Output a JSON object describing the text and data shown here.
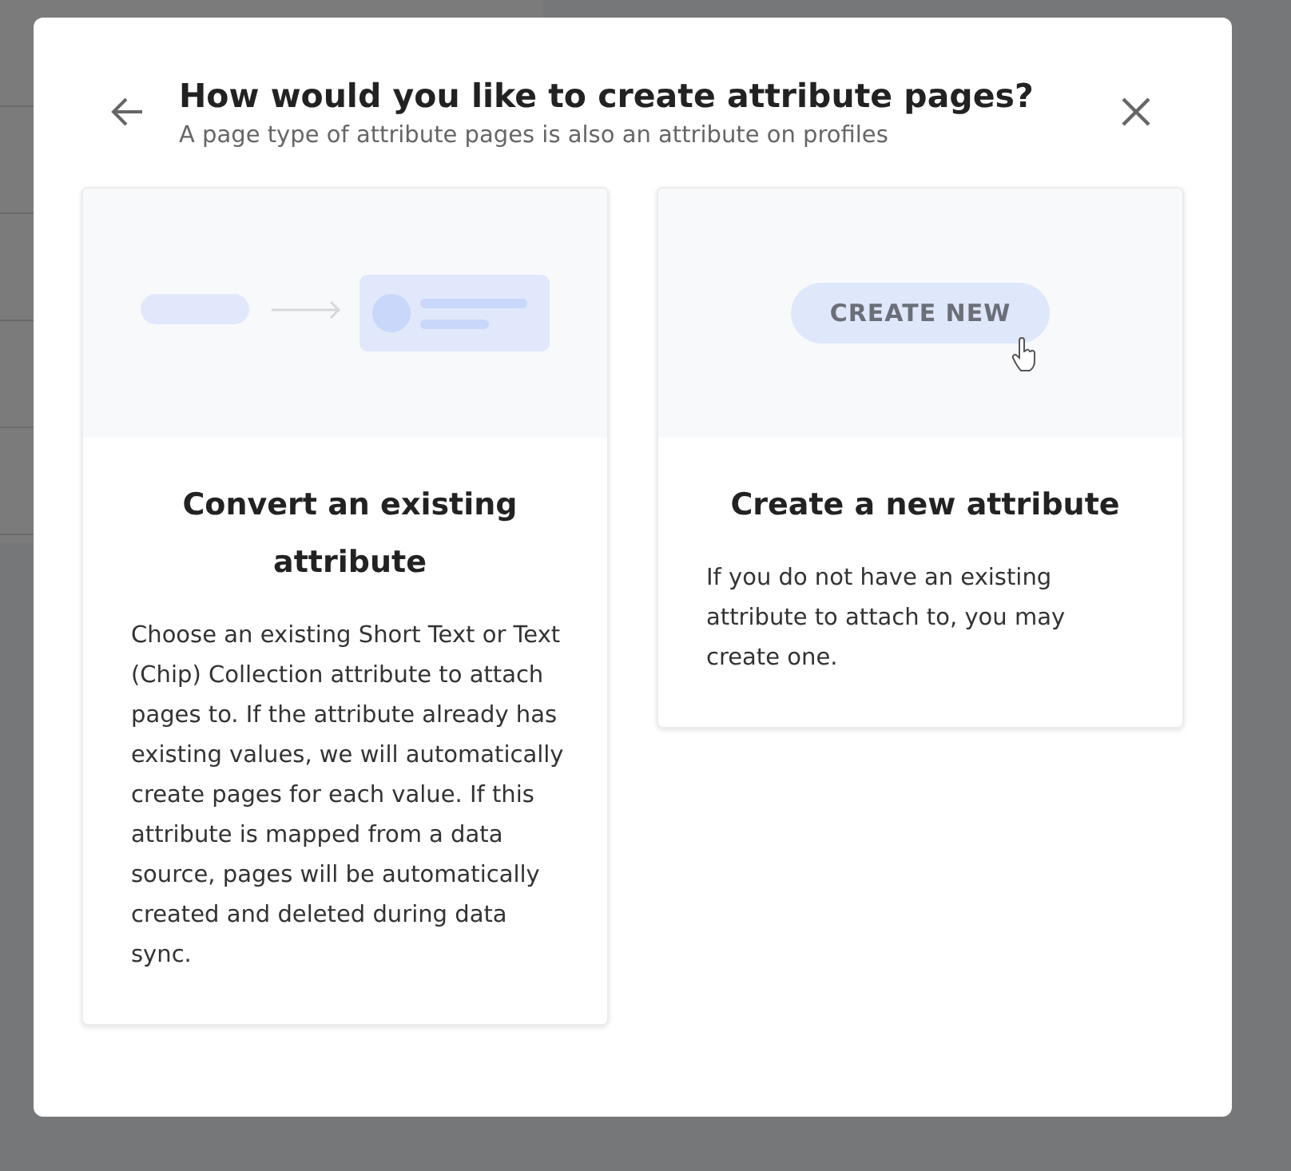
{
  "dialog": {
    "title": "How would you like to create attribute pages?",
    "subtitle": "A page type of attribute pages is also an attribute on profiles"
  },
  "options": [
    {
      "kind": "convert",
      "title": "Convert an existing attribute",
      "description": "Choose an existing Short Text or Text (Chip) Collection attribute to attach pages to. If the attribute already has existing values, we will automatically create pages for each value. If this attribute is mapped from a data source, pages will be automatically created and deleted during data sync."
    },
    {
      "kind": "create",
      "title": "Create a new attribute",
      "description": "If you do not have an existing attribute to attach to, you may create one.",
      "button_label": "CREATE NEW"
    }
  ]
}
